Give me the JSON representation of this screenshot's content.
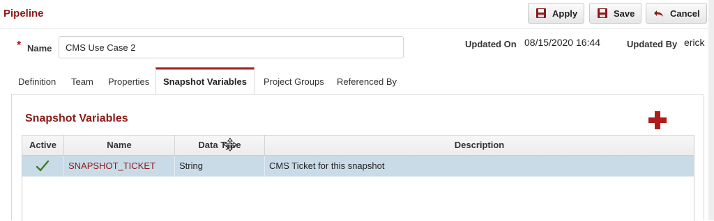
{
  "header": {
    "title": "Pipeline",
    "buttons": {
      "apply": "Apply",
      "save": "Save",
      "cancel": "Cancel"
    }
  },
  "name_field": {
    "label": "Name",
    "required_marker": "*",
    "value": "CMS Use Case 2"
  },
  "meta": {
    "updated_on_label": "Updated On",
    "updated_on_value": "08/15/2020 16:44",
    "updated_by_label": "Updated By",
    "updated_by_value": "erick"
  },
  "tabs": [
    {
      "label": "Definition",
      "active": false
    },
    {
      "label": "Team",
      "active": false
    },
    {
      "label": "Properties",
      "active": false
    },
    {
      "label": "Snapshot Variables",
      "active": true
    },
    {
      "label": "Project Groups",
      "active": false
    },
    {
      "label": "Referenced By",
      "active": false
    }
  ],
  "section": {
    "title": "Snapshot Variables"
  },
  "table": {
    "columns": [
      "Active",
      "Name",
      "Data Type",
      "Description"
    ],
    "rows": [
      {
        "active": true,
        "name": "SNAPSHOT_TICKET",
        "data_type": "String",
        "description": "CMS Ticket for this snapshot"
      }
    ]
  },
  "colors": {
    "brand": "#8b1a1a",
    "accent": "#b01c1c",
    "selected_row": "#c9dbe7",
    "check": "#3d7a2a"
  },
  "icons": [
    "floppy-disk-icon",
    "undo-arrow-icon",
    "plus-icon",
    "checkmark-icon",
    "move-cursor-icon"
  ]
}
